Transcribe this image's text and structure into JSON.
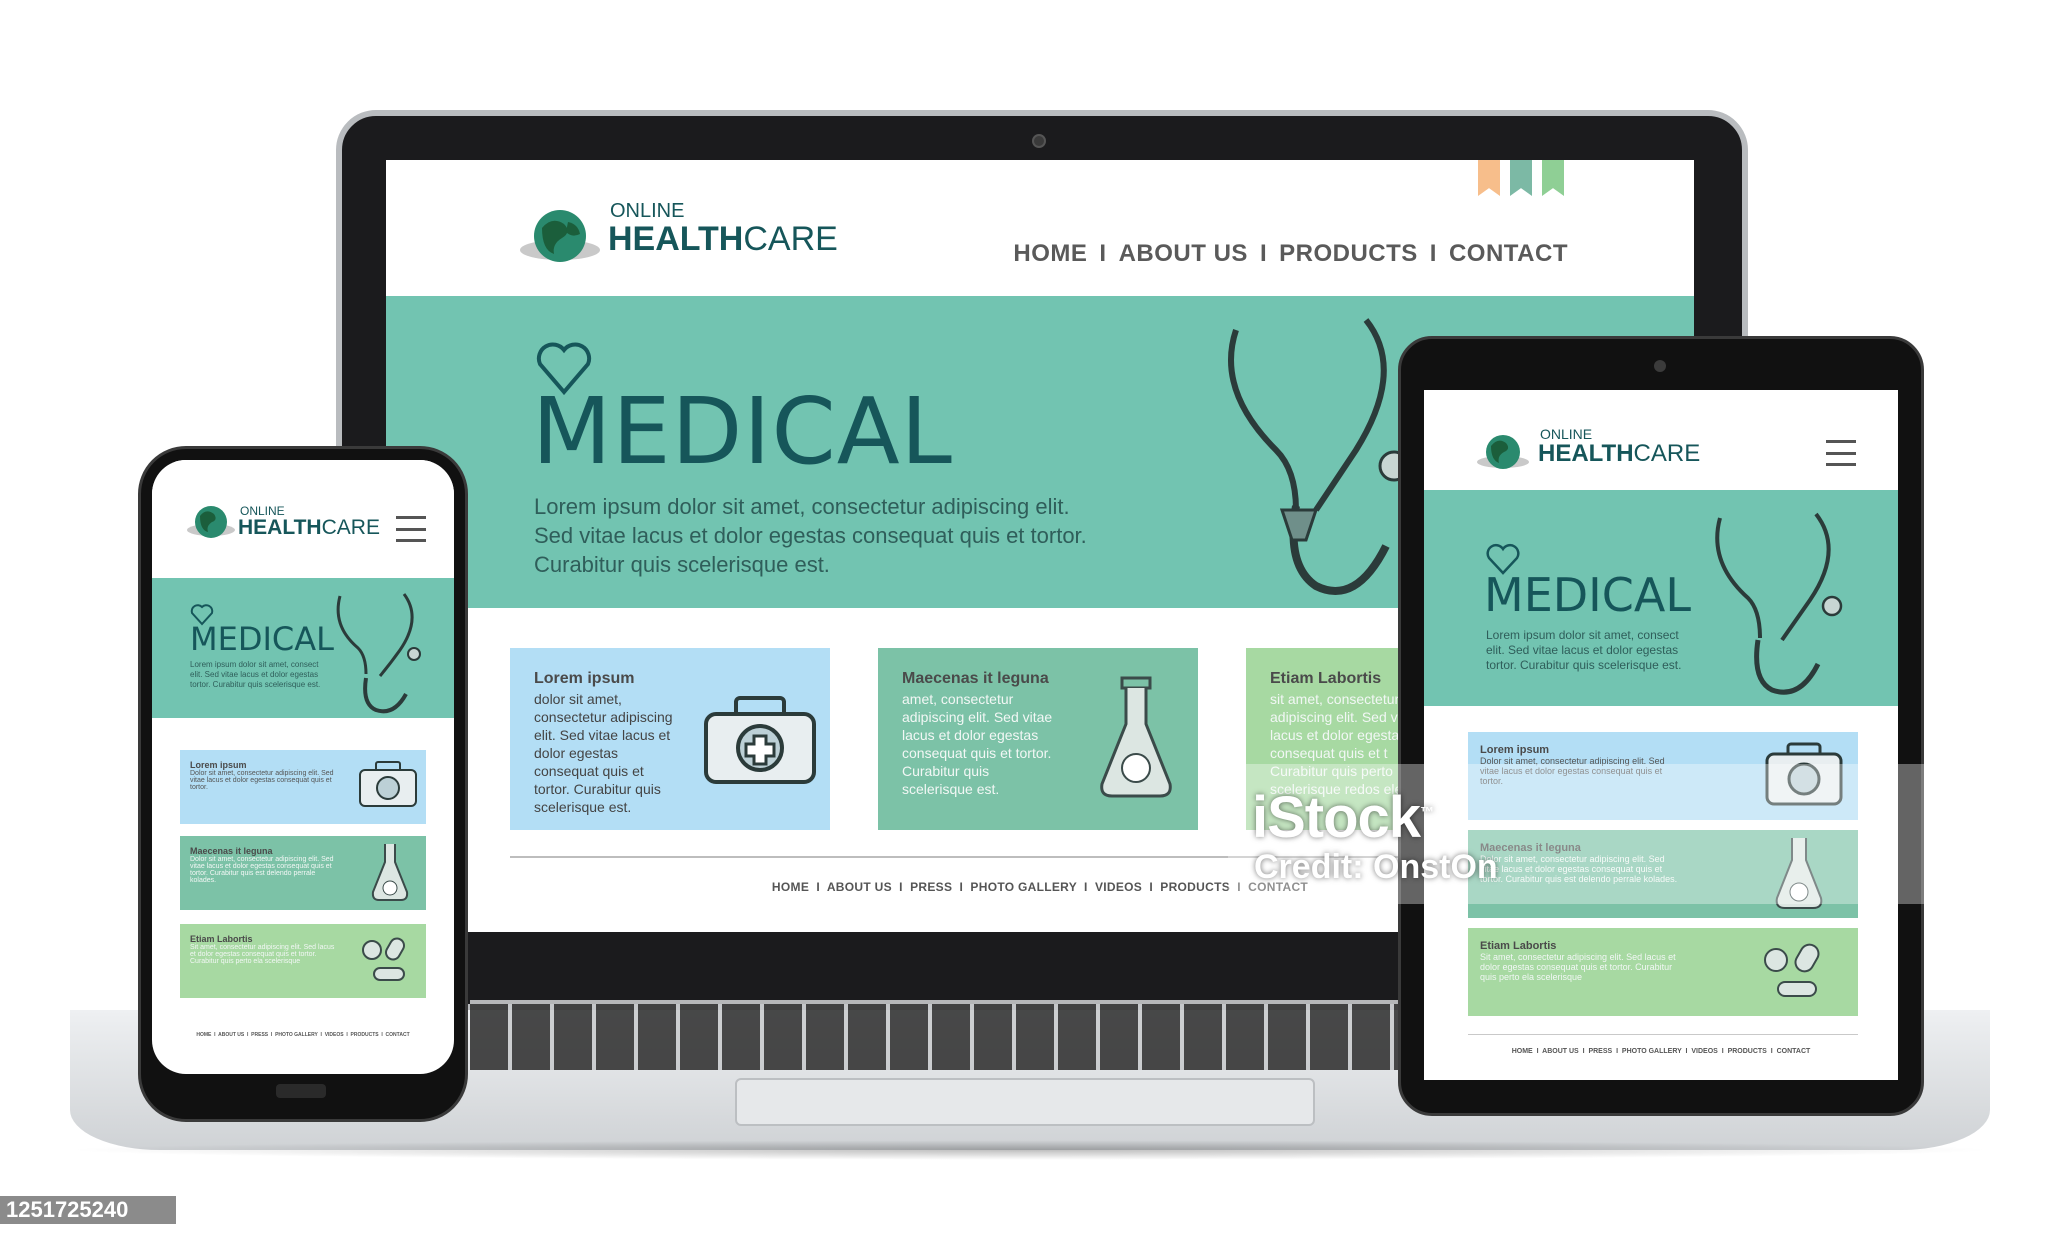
{
  "colors": {
    "brand_teal": "#72c4b1",
    "dark_teal": "#16565a",
    "card_blue": "#b3def5",
    "card_green": "#7cc2a7",
    "card_light_green": "#a7d9a2",
    "ribbon_orange": "#f7be8b",
    "ribbon_teal": "#7cb9a5",
    "ribbon_green": "#8fcf95"
  },
  "logo": {
    "line1": "ONLINE",
    "line2_a": "HEALTH",
    "line2_b": "CARE",
    "icon": "globe-icon"
  },
  "nav": {
    "home": "HOME",
    "about": "ABOUT US",
    "products": "PRODUCTS",
    "contact": "CONTACT",
    "sep": "I"
  },
  "hero": {
    "title": "MEDICAL",
    "text": "Lorem ipsum dolor sit amet, consectetur adipiscing elit. Sed vitae lacus et dolor egestas consequat quis et tortor. Curabitur quis scelerisque est.",
    "text_short": "Lorem ipsum dolor sit amet, consect elit. Sed vitae lacus et dolor egestas tortor. Curabitur quis scelerisque est.",
    "text_phone": "Lorem ipsum dolor sit amet, consect elit. Sed vitae lacus et dolor egestas tortor. Curabitur quis scelerisque est.",
    "icons": [
      "heart-icon",
      "stethoscope-icon"
    ]
  },
  "cards": [
    {
      "title": "Lorem ipsum",
      "text": "dolor sit amet, consectetur adipiscing elit. Sed vitae lacus et dolor egestas consequat quis et tortor. Curabitur quis scelerisque est.",
      "icon": "first-aid-kit-icon"
    },
    {
      "title": "Maecenas it leguna",
      "text": "amet, consectetur adipiscing elit. Sed vitae lacus et dolor egestas consequat quis et tortor. Curabitur quis scelerisque est.",
      "icon": "flask-icon"
    },
    {
      "title": "Etiam Labortis",
      "text": "sit amet, consectetur adipiscing elit. Sed v lacus et dolor egestas consequat quis et t Curabitur quis perto scelerisque redos ele",
      "icon": "pills-icon"
    }
  ],
  "mini_cards": [
    {
      "title": "Lorem ipsum",
      "text": "Dolor sit amet, consectetur adipiscing elit. Sed vitae lacus et dolor egestas consequat quis et tortor."
    },
    {
      "title": "Maecenas it leguna",
      "text": "Dolor sit amet, consectetur adipiscing elit. Sed vitae lacus et dolor egestas consequat quis et tortor. Curabitur quis est delendo perrale kolades."
    },
    {
      "title": "Etiam Labortis",
      "text": "Sit amet, consectetur adipiscing elit. Sed lacus et dolor egestas consequat quis et tortor. Curabitur quis perto ela scelerisque"
    }
  ],
  "footer": {
    "links": [
      "HOME",
      "ABOUT US",
      "PRESS",
      "PHOTO GALLERY",
      "VIDEOS",
      "PRODUCTS",
      "CONTACT"
    ],
    "text": "HOME  I  ABOUT US  I  PRESS  I  PHOTO GALLERY  I  VIDEOS  I  PRODUCTS  I  CONTACT"
  },
  "watermark": {
    "brand": "iStock",
    "tm": "™",
    "credit": "Credit: OnstOn"
  },
  "image_id": "1251725240"
}
